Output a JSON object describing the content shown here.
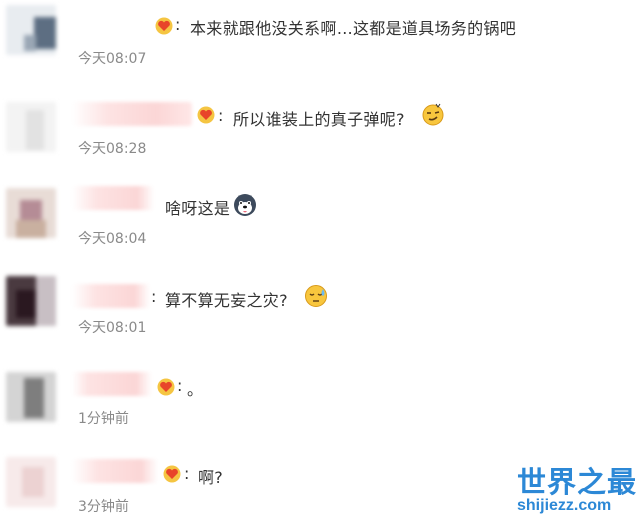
{
  "comments": [
    {
      "message": "本来就跟他没关系啊…这都是道具场务的锅吧",
      "time": "今天08:07",
      "badge": "heart-badge-icon",
      "emoji": null
    },
    {
      "message": "所以谁装上的真子弹呢?",
      "time": "今天08:28",
      "badge": "heart-badge-icon",
      "emoji": "smirk-emoji-icon"
    },
    {
      "message": "啥呀这是",
      "time": "今天08:04",
      "badge": null,
      "emoji": "husky-emoji-icon"
    },
    {
      "message": "算不算无妄之灾?",
      "time": "今天08:01",
      "badge": null,
      "emoji": "sweat-emoji-icon"
    },
    {
      "message": "。",
      "time": "1分钟前",
      "badge": "heart-badge-icon",
      "emoji": null
    },
    {
      "message": "啊?",
      "time": "3分钟前",
      "badge": "heart-badge-icon",
      "emoji": null
    }
  ],
  "colon": ":",
  "watermark": {
    "title": "世界之最",
    "url": "shijiezz.com"
  },
  "colors": {
    "text": "#333333",
    "time": "#8a8a8a",
    "badge": "#e8452a",
    "watermark": "#2c88d6"
  }
}
